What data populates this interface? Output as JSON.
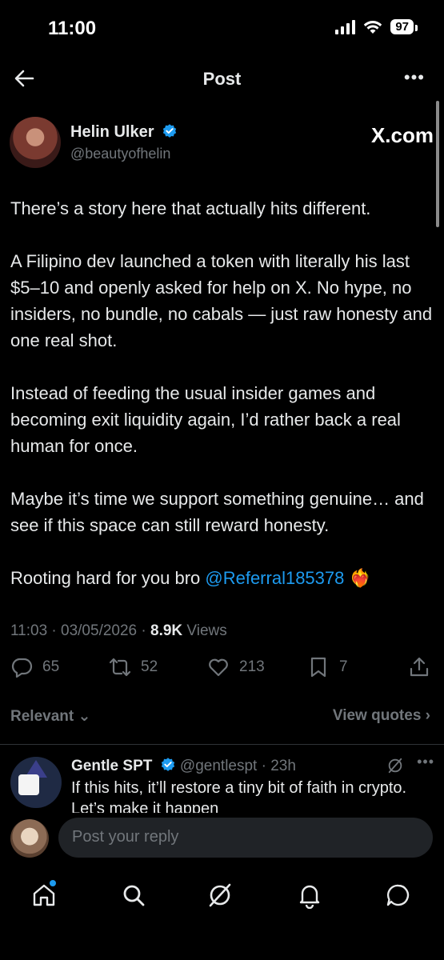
{
  "status_bar": {
    "time": "11:00",
    "battery": "97"
  },
  "nav": {
    "title": "Post"
  },
  "post": {
    "author_name": "Helin Ulker",
    "author_handle": "@beautyofhelin",
    "source_badge": "X.com",
    "paragraphs": [
      "There’s a story here that actually hits different.",
      "A Filipino dev launched a token with literally his last $5–10 and openly asked for help on X. No hype, no insiders, no bundle, no cabals — just raw honesty and one real shot.",
      "Instead of feeding the usual insider games and becoming exit liquidity again, I’d rather back a real human for once.",
      "Maybe it’s time we support something genuine… and see if this space can still reward honesty."
    ],
    "closing_text": "Rooting hard for you bro ",
    "mention": "@Referral185378",
    "emoji": "❤️‍🔥",
    "timestamp": "11:03 · 03/05/2026 · ",
    "views_count": "8.9K",
    "views_label": " Views"
  },
  "actions": {
    "replies": "65",
    "reposts": "52",
    "likes": "213",
    "bookmarks": "7"
  },
  "filter": {
    "sort_label": "Relevant ⌄",
    "quotes_label": "View quotes ›"
  },
  "reply": {
    "name": "Gentle SPT",
    "handle_time": "@gentlespt · 23h",
    "text": "If this hits, it’ll restore a tiny bit of faith in crypto. Let’s make it happen"
  },
  "composer": {
    "placeholder": "Post your reply"
  },
  "colors": {
    "accent": "#1d9bf0",
    "background": "#000000",
    "muted": "#71767b",
    "text": "#e7e9ea"
  }
}
